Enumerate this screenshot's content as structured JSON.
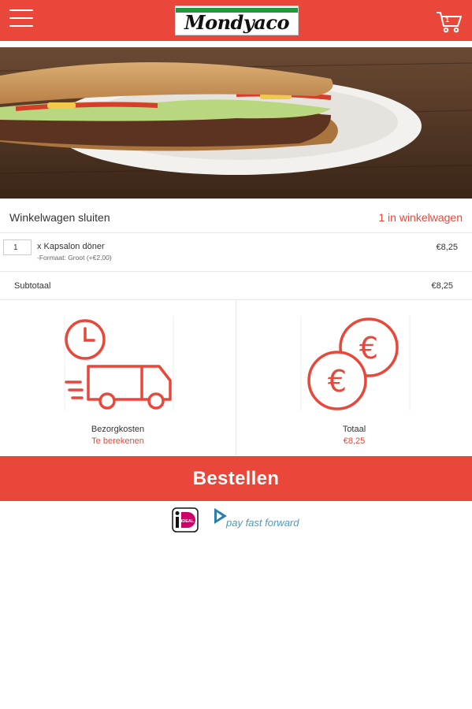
{
  "header": {
    "logo_text": "Mondyaco",
    "cart_count": "1",
    "brand_color": "#e8473a",
    "menu_icon": "hamburger-menu-icon",
    "cart_icon": "shopping-cart-icon"
  },
  "hero": {
    "image": "kapsalon-sandwich-photo"
  },
  "cart": {
    "close_label": "Winkelwagen sluiten",
    "count_label": "1 in winkelwagen",
    "items": [
      {
        "quantity": "1",
        "name": "x Kapsalon döner",
        "option": "-Formaat: Groot (+€2,00)",
        "price": "€8,25"
      }
    ],
    "subtotal_label": "Subtotaal",
    "subtotal_value": "€8,25"
  },
  "summary": {
    "delivery": {
      "icon": "delivery-truck-clock-icon",
      "label": "Bezorgkosten",
      "value": "Te berekenen"
    },
    "total": {
      "icon": "euro-coins-icon",
      "label": "Totaal",
      "value": "€8,25"
    }
  },
  "order_button": {
    "label": "Bestellen"
  },
  "payment": {
    "ideal_text": "iDEAL",
    "pff_text": "pay fast forward"
  }
}
